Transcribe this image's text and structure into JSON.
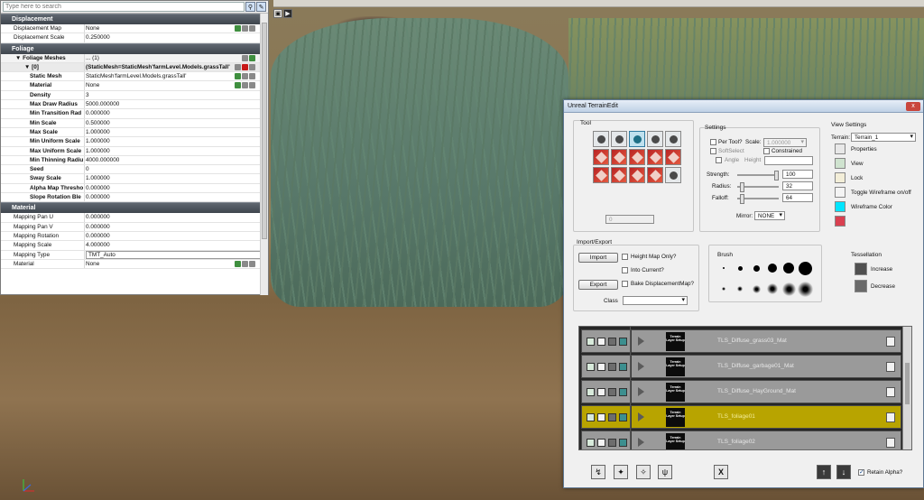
{
  "search": {
    "placeholder": "Type here to search"
  },
  "properties": {
    "displacement": {
      "title": "Displacement",
      "rows": [
        {
          "name": "Displacement Map",
          "value": "None"
        },
        {
          "name": "Displacement Scale",
          "value": "0.250000"
        }
      ]
    },
    "foliage": {
      "title": "Foliage",
      "meshes_label": "Foliage Meshes",
      "meshes_value": "... (1)",
      "index_label": "[0]",
      "index_value": "(StaticMesh=StaticMesh'farmLevel.Models.grassTall'",
      "rows": [
        {
          "name": "Static Mesh",
          "value": "StaticMesh'farmLevel.Models.grassTall'"
        },
        {
          "name": "Material",
          "value": "None"
        },
        {
          "name": "Density",
          "value": "3"
        },
        {
          "name": "Max Draw Radius",
          "value": "5000.000000"
        },
        {
          "name": "Min Transition Rad",
          "value": "0.000000"
        },
        {
          "name": "Min Scale",
          "value": "0.500000"
        },
        {
          "name": "Max Scale",
          "value": "1.000000"
        },
        {
          "name": "Min Uniform Scale",
          "value": "1.000000"
        },
        {
          "name": "Max Uniform Scale",
          "value": "1.000000"
        },
        {
          "name": "Min Thinning Radiu",
          "value": "4000.000000"
        },
        {
          "name": "Seed",
          "value": "0"
        },
        {
          "name": "Sway Scale",
          "value": "1.000000"
        },
        {
          "name": "Alpha Map Thresho",
          "value": "0.000000"
        },
        {
          "name": "Slope Rotation Ble",
          "value": "0.000000"
        }
      ]
    },
    "material": {
      "title": "Material",
      "rows": [
        {
          "name": "Mapping Pan U",
          "value": "0.000000"
        },
        {
          "name": "Mapping Pan V",
          "value": "0.000000"
        },
        {
          "name": "Mapping Rotation",
          "value": "0.000000"
        },
        {
          "name": "Mapping Scale",
          "value": "4.000000"
        },
        {
          "name": "Mapping Type",
          "value": "TMT_Auto"
        },
        {
          "name": "Material",
          "value": "None"
        }
      ]
    }
  },
  "terrain": {
    "title": "Unreal TerrainEdit",
    "close_label": "x",
    "tool_label": "Tool",
    "tool_value": "0",
    "settings": {
      "label": "Settings",
      "per_tool": "Per Tool?",
      "scale_label": "Scale:",
      "scale_value": "1.000000",
      "soft_select": "SoftSelect",
      "constrained": "Constrained",
      "angle": "Angle",
      "height": "Height",
      "strength_label": "Strength:",
      "strength_value": "100",
      "radius_label": "Radius:",
      "radius_value": "32",
      "falloff_label": "Falloff:",
      "falloff_value": "64",
      "mirror_label": "Mirror:",
      "mirror_value": "NONE"
    },
    "view": {
      "label": "View Settings",
      "terrain_label": "Terrain:",
      "terrain_value": "Terrain_1",
      "items": [
        "Properties",
        "View",
        "Lock",
        "Toggle Wireframe on/off",
        "Wireframe Color"
      ]
    },
    "import_export": {
      "label": "Import/Export",
      "import_btn": "Import",
      "export_btn": "Export",
      "height_map_only": "Height Map Only?",
      "into_current": "Into Current?",
      "bake_displacement": "Bake DisplacementMap?",
      "class_label": "Class"
    },
    "brush_label": "Brush",
    "tessellation": {
      "label": "Tessellation",
      "increase": "Increase",
      "decrease": "Decrease"
    },
    "layers": [
      {
        "name": "TLS_Diffuse_grass03_Mat",
        "thumb": "Terrain Layer Setup",
        "selected": false
      },
      {
        "name": "TLS_Diffuse_garbage01_Mat",
        "thumb": "Terrain Layer Setup",
        "selected": false
      },
      {
        "name": "TLS_Diffuse_HayGround_Mat",
        "thumb": "Terrain Layer Setup",
        "selected": false
      },
      {
        "name": "TLS_foliage01",
        "thumb": "Terrain Layer Setup",
        "selected": true
      },
      {
        "name": "TLS_foliage02",
        "thumb": "Terrain Layer Setup",
        "selected": false
      }
    ],
    "retain_alpha": "Retain Alpha?",
    "delete_label": "X",
    "up_label": "↑",
    "down_label": "↓"
  },
  "colors": {
    "selected_layer": "#b8a400",
    "wireframe": "#00e5ff"
  }
}
